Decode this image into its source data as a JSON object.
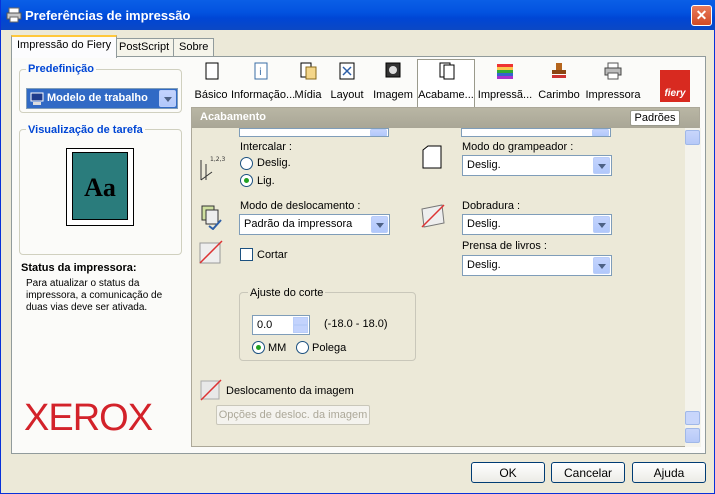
{
  "window": {
    "title": "Preferências de impressão",
    "close": "✕"
  },
  "tabs": [
    "Impressão do Fiery",
    "PostScript",
    "Sobre"
  ],
  "left": {
    "preset_title": "Predefinição",
    "preset_value": "Modelo de trabalho",
    "preview_title": "Visualização de tarefa",
    "preview_text": "Aa",
    "status_title": "Status da impressora:",
    "status_text": "Para atualizar o status da impressora, a comunicação de duas vias deve ser ativada.",
    "brand": "XEROX"
  },
  "toolbar": {
    "items": [
      "Básico",
      "Informação...",
      "Mídia",
      "Layout",
      "Imagem",
      "Acabame...",
      "Impressã...",
      "Carimbo",
      "Impressora"
    ],
    "brand": "fiery"
  },
  "section": {
    "title": "Acabamento",
    "defaults_button": "Padrões"
  },
  "form": {
    "collate_label": "Intercalar :",
    "collate_off": "Deslig.",
    "collate_on": "Lig.",
    "stapler_label": "Modo do grampeador :",
    "stapler_value": "Deslig.",
    "offset_label": "Modo de deslocamento :",
    "offset_value": "Padrão da impressora",
    "fold_label": "Dobradura :",
    "fold_value": "Deslig.",
    "bookpress_label": "Prensa de livros :",
    "bookpress_value": "Deslig.",
    "trim_label": "Cortar",
    "trim_group_title": "Ajuste do corte",
    "trim_value": "0.0",
    "trim_range": "(-18.0 - 18.0)",
    "unit_mm": "MM",
    "unit_inch": "Polega",
    "image_shift_label": "Deslocamento da imagem",
    "image_shift_options": "Opções de desloc. da imagem"
  },
  "buttons": {
    "ok": "OK",
    "cancel": "Cancelar",
    "help": "Ajuda"
  }
}
